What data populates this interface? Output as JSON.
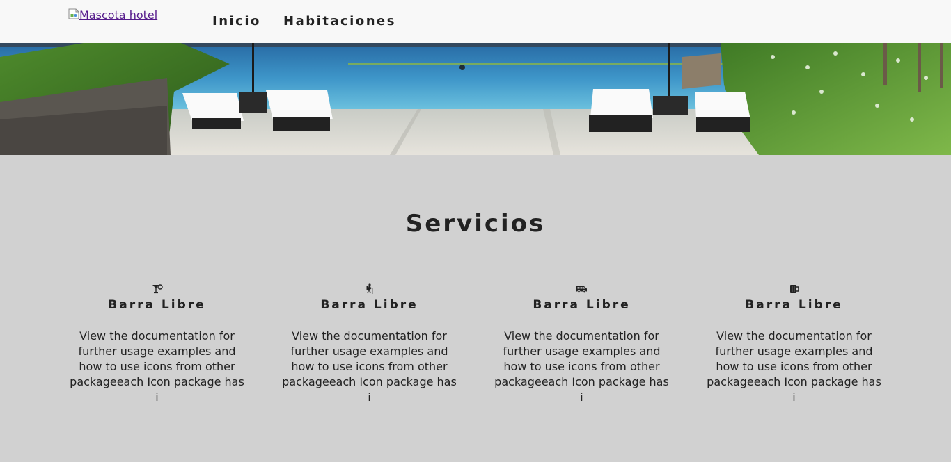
{
  "nav": {
    "logo_alt": "Mascota hotel",
    "links": [
      "Inicio",
      "Habitaciones"
    ]
  },
  "services": {
    "title": "Servicios",
    "cards": [
      {
        "icon": "cocktail-icon",
        "title": "Barra Libre",
        "text": "View the documentation for further usage examples and how to use icons from other packageeach Icon package has i"
      },
      {
        "icon": "hiking-icon",
        "title": "Barra Libre",
        "text": "View the documentation for further usage examples and how to use icons from other packageeach Icon package has i"
      },
      {
        "icon": "shuttle-van-icon",
        "title": "Barra Libre",
        "text": "View the documentation for further usage examples and how to use icons from other packageeach Icon package has i"
      },
      {
        "icon": "beer-mug-icon",
        "title": "Barra Libre",
        "text": "View the documentation for further usage examples and how to use icons from other packageeach Icon package has i"
      }
    ]
  },
  "colors": {
    "nav_bg": "#f8f8f8",
    "page_bg": "#d1d1d1",
    "text": "#222222",
    "link_visited": "#551a8b"
  }
}
